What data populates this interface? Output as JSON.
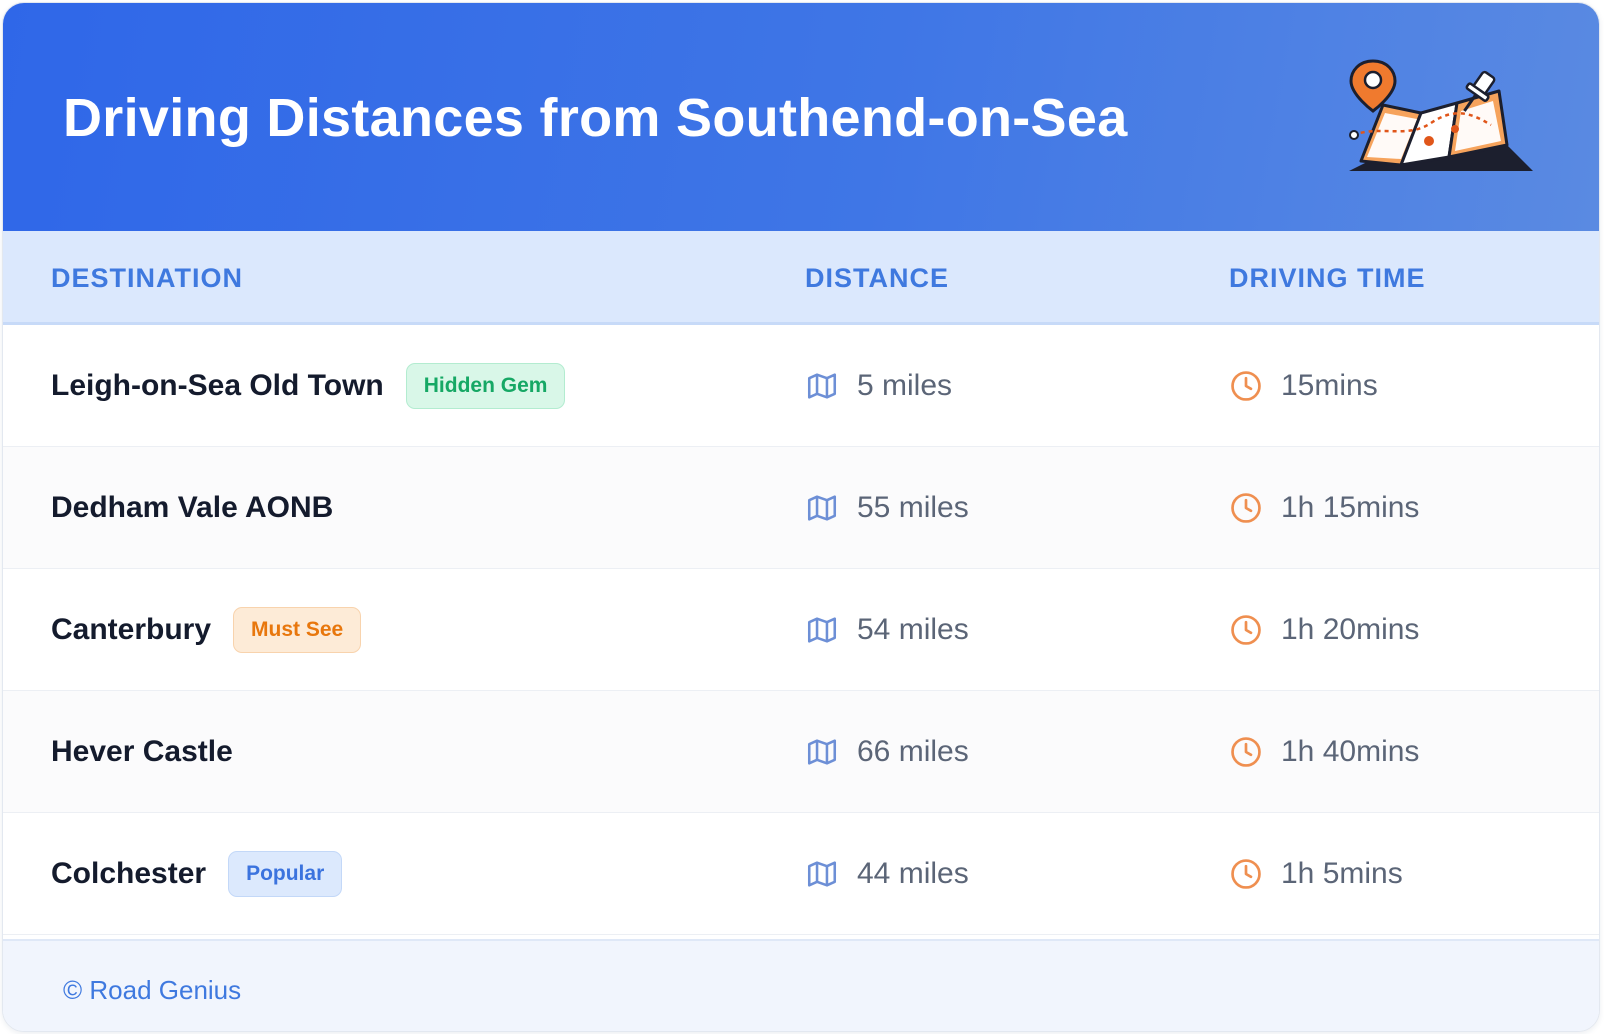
{
  "header": {
    "title": "Driving Distances from Southend-on-Sea",
    "illustration_icon": "folded-map-with-pin-icon"
  },
  "columns": {
    "destination": "DESTINATION",
    "distance": "DISTANCE",
    "time": "DRIVING TIME"
  },
  "icons": {
    "distance": "map-icon",
    "time": "clock-icon"
  },
  "colors": {
    "header_gradient_start": "#2f67e8",
    "header_gradient_end": "#5a8ae2",
    "column_header_bg": "#dbe8fd",
    "column_header_text": "#3f79df",
    "map_icon": "#6d8fd6",
    "clock_icon": "#ef8f50"
  },
  "rows": [
    {
      "destination": "Leigh-on-Sea Old Town",
      "badge": {
        "label": "Hidden Gem",
        "color": "#16a865",
        "bg": "#d9f7e8",
        "border": "#b3ecd0"
      },
      "distance": "5 miles",
      "time": "15mins"
    },
    {
      "destination": "Dedham Vale AONB",
      "badge": null,
      "distance": "55 miles",
      "time": "1h 15mins"
    },
    {
      "destination": "Canterbury",
      "badge": {
        "label": "Must See",
        "color": "#e8770d",
        "bg": "#fdebd7",
        "border": "#f8d3ad"
      },
      "distance": "54 miles",
      "time": "1h 20mins"
    },
    {
      "destination": "Hever Castle",
      "badge": null,
      "distance": "66 miles",
      "time": "1h 40mins"
    },
    {
      "destination": "Colchester",
      "badge": {
        "label": "Popular",
        "color": "#3b73de",
        "bg": "#dce9fd",
        "border": "#c3d8f8"
      },
      "distance": "44 miles",
      "time": "1h 5mins"
    }
  ],
  "footer": {
    "copyright": "© Road Genius"
  }
}
